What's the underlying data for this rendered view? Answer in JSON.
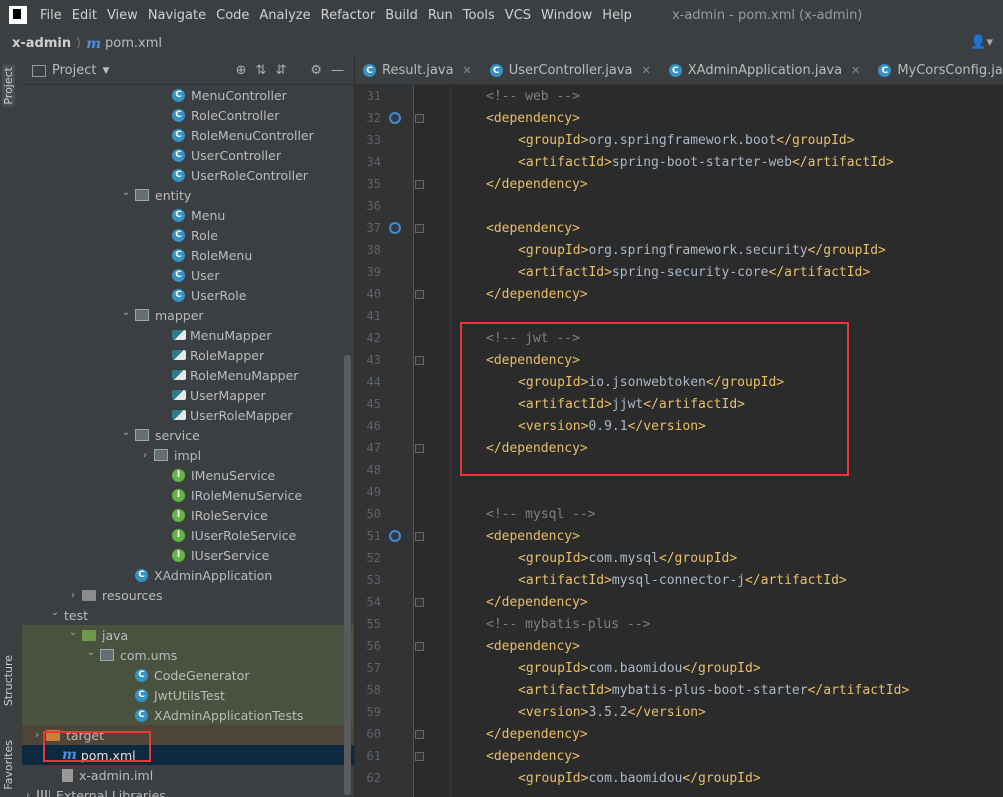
{
  "menubar": {
    "items": [
      "File",
      "Edit",
      "View",
      "Navigate",
      "Code",
      "Analyze",
      "Refactor",
      "Build",
      "Run",
      "Tools",
      "VCS",
      "Window",
      "Help"
    ],
    "window_title": "x-admin - pom.xml (x-admin)"
  },
  "navbar": {
    "project": "x-admin",
    "file": "pom.xml",
    "file_icon": "m"
  },
  "sidebar": {
    "project_tab": "Project",
    "structure_tab": "Structure",
    "favorites_tab": "Favorites"
  },
  "project_panel": {
    "title": "Project",
    "tree": [
      {
        "indent": 150,
        "arrow": "",
        "icon": "c",
        "label": "MenuController"
      },
      {
        "indent": 150,
        "arrow": "",
        "icon": "c",
        "label": "RoleController"
      },
      {
        "indent": 150,
        "arrow": "",
        "icon": "c",
        "label": "RoleMenuController"
      },
      {
        "indent": 150,
        "arrow": "",
        "icon": "c",
        "label": "UserController"
      },
      {
        "indent": 150,
        "arrow": "",
        "icon": "c",
        "label": "UserRoleController"
      },
      {
        "indent": 113,
        "arrow": "down",
        "icon": "pkg",
        "label": "entity"
      },
      {
        "indent": 150,
        "arrow": "",
        "icon": "c",
        "label": "Menu"
      },
      {
        "indent": 150,
        "arrow": "",
        "icon": "c",
        "label": "Role"
      },
      {
        "indent": 150,
        "arrow": "",
        "icon": "c",
        "label": "RoleMenu"
      },
      {
        "indent": 150,
        "arrow": "",
        "icon": "c",
        "label": "User"
      },
      {
        "indent": 150,
        "arrow": "",
        "icon": "c",
        "label": "UserRole"
      },
      {
        "indent": 113,
        "arrow": "down",
        "icon": "pkg",
        "label": "mapper"
      },
      {
        "indent": 150,
        "arrow": "",
        "icon": "mapper",
        "label": "MenuMapper"
      },
      {
        "indent": 150,
        "arrow": "",
        "icon": "mapper",
        "label": "RoleMapper"
      },
      {
        "indent": 150,
        "arrow": "",
        "icon": "mapper",
        "label": "RoleMenuMapper"
      },
      {
        "indent": 150,
        "arrow": "",
        "icon": "mapper",
        "label": "UserMapper"
      },
      {
        "indent": 150,
        "arrow": "",
        "icon": "mapper",
        "label": "UserRoleMapper"
      },
      {
        "indent": 113,
        "arrow": "down",
        "icon": "pkg",
        "label": "service"
      },
      {
        "indent": 132,
        "arrow": "right",
        "icon": "pkg",
        "label": "impl"
      },
      {
        "indent": 150,
        "arrow": "",
        "icon": "i",
        "label": "IMenuService"
      },
      {
        "indent": 150,
        "arrow": "",
        "icon": "i",
        "label": "IRoleMenuService"
      },
      {
        "indent": 150,
        "arrow": "",
        "icon": "i",
        "label": "IRoleService"
      },
      {
        "indent": 150,
        "arrow": "",
        "icon": "i",
        "label": "IUserRoleService"
      },
      {
        "indent": 150,
        "arrow": "",
        "icon": "i",
        "label": "IUserService"
      },
      {
        "indent": 113,
        "arrow": "",
        "icon": "c",
        "label": "XAdminApplication"
      },
      {
        "indent": 60,
        "arrow": "right",
        "icon": "folder-grey",
        "label": "resources"
      },
      {
        "indent": 42,
        "arrow": "down",
        "icon": "",
        "label": "test"
      },
      {
        "indent": 60,
        "arrow": "down",
        "icon": "folder-green",
        "label": "java",
        "hl": "green"
      },
      {
        "indent": 78,
        "arrow": "down",
        "icon": "pkg",
        "label": "com.ums",
        "hl": "green"
      },
      {
        "indent": 113,
        "arrow": "",
        "icon": "c",
        "label": "CodeGenerator",
        "hl": "green"
      },
      {
        "indent": 113,
        "arrow": "",
        "icon": "c",
        "label": "JwtUtilsTest",
        "hl": "green"
      },
      {
        "indent": 113,
        "arrow": "",
        "icon": "c",
        "label": "XAdminApplicationTests",
        "hl": "green"
      },
      {
        "indent": 24,
        "arrow": "right",
        "icon": "folder-orange",
        "label": "target",
        "hl": "brown"
      },
      {
        "indent": 40,
        "arrow": "",
        "icon": "m",
        "label": "pom.xml",
        "sel": true
      },
      {
        "indent": 40,
        "arrow": "",
        "icon": "iml",
        "label": "x-admin.iml"
      },
      {
        "indent": 6,
        "arrow": "right",
        "icon": "libs",
        "label": "External Libraries"
      }
    ]
  },
  "editor": {
    "tabs": [
      "Result.java",
      "UserController.java",
      "XAdminApplication.java",
      "MyCorsConfig.java"
    ],
    "lines": [
      {
        "n": "31",
        "indent": 2,
        "parts": [
          {
            "c": "cm",
            "t": "<!-- web -->"
          }
        ]
      },
      {
        "n": "32",
        "indent": 2,
        "mark": true,
        "fold": true,
        "parts": [
          {
            "c": "tg",
            "t": "<dependency>"
          }
        ]
      },
      {
        "n": "33",
        "indent": 4,
        "parts": [
          {
            "c": "tg",
            "t": "<groupId>"
          },
          {
            "c": "tx",
            "t": "org.springframework.boot"
          },
          {
            "c": "tg",
            "t": "</groupId>"
          }
        ]
      },
      {
        "n": "34",
        "indent": 4,
        "parts": [
          {
            "c": "tg",
            "t": "<artifactId>"
          },
          {
            "c": "tx",
            "t": "spring-boot-starter-web"
          },
          {
            "c": "tg",
            "t": "</artifactId>"
          }
        ]
      },
      {
        "n": "35",
        "indent": 2,
        "fold": true,
        "parts": [
          {
            "c": "tg",
            "t": "</dependency>"
          }
        ]
      },
      {
        "n": "36",
        "indent": 0,
        "parts": []
      },
      {
        "n": "37",
        "indent": 2,
        "mark": true,
        "fold": true,
        "parts": [
          {
            "c": "tg",
            "t": "<dependency>"
          }
        ]
      },
      {
        "n": "38",
        "indent": 4,
        "parts": [
          {
            "c": "tg",
            "t": "<groupId>"
          },
          {
            "c": "tx",
            "t": "org.springframework.security"
          },
          {
            "c": "tg",
            "t": "</groupId>"
          }
        ]
      },
      {
        "n": "39",
        "indent": 4,
        "parts": [
          {
            "c": "tg",
            "t": "<artifactId>"
          },
          {
            "c": "tx",
            "t": "spring-security-core"
          },
          {
            "c": "tg",
            "t": "</artifactId>"
          }
        ]
      },
      {
        "n": "40",
        "indent": 2,
        "fold": true,
        "parts": [
          {
            "c": "tg",
            "t": "</dependency>"
          }
        ]
      },
      {
        "n": "41",
        "indent": 0,
        "parts": []
      },
      {
        "n": "42",
        "indent": 2,
        "parts": [
          {
            "c": "cm",
            "t": "<!-- jwt -->"
          }
        ]
      },
      {
        "n": "43",
        "indent": 2,
        "fold": true,
        "parts": [
          {
            "c": "tg",
            "t": "<dependency>"
          }
        ]
      },
      {
        "n": "44",
        "indent": 4,
        "parts": [
          {
            "c": "tg",
            "t": "<groupId>"
          },
          {
            "c": "tx",
            "t": "io.jsonwebtoken"
          },
          {
            "c": "tg",
            "t": "</groupId>"
          }
        ]
      },
      {
        "n": "45",
        "indent": 4,
        "parts": [
          {
            "c": "tg",
            "t": "<artifactId>"
          },
          {
            "c": "tx",
            "t": "jjwt"
          },
          {
            "c": "tg",
            "t": "</artifactId>"
          }
        ]
      },
      {
        "n": "46",
        "indent": 4,
        "parts": [
          {
            "c": "tg",
            "t": "<version>"
          },
          {
            "c": "tx",
            "t": "0.9.1"
          },
          {
            "c": "tg",
            "t": "</version>"
          }
        ]
      },
      {
        "n": "47",
        "indent": 2,
        "fold": true,
        "parts": [
          {
            "c": "tg",
            "t": "</dependency>"
          }
        ]
      },
      {
        "n": "48",
        "indent": 0,
        "parts": []
      },
      {
        "n": "49",
        "indent": 0,
        "parts": []
      },
      {
        "n": "50",
        "indent": 2,
        "parts": [
          {
            "c": "cm",
            "t": "<!-- mysql -->"
          }
        ]
      },
      {
        "n": "51",
        "indent": 2,
        "mark": true,
        "fold": true,
        "parts": [
          {
            "c": "tg",
            "t": "<dependency>"
          }
        ]
      },
      {
        "n": "52",
        "indent": 4,
        "parts": [
          {
            "c": "tg",
            "t": "<groupId>"
          },
          {
            "c": "tx",
            "t": "com.mysql"
          },
          {
            "c": "tg",
            "t": "</groupId>"
          }
        ]
      },
      {
        "n": "53",
        "indent": 4,
        "parts": [
          {
            "c": "tg",
            "t": "<artifactId>"
          },
          {
            "c": "tx",
            "t": "mysql-connector-j"
          },
          {
            "c": "tg",
            "t": "</artifactId>"
          }
        ]
      },
      {
        "n": "54",
        "indent": 2,
        "fold": true,
        "parts": [
          {
            "c": "tg",
            "t": "</dependency>"
          }
        ]
      },
      {
        "n": "55",
        "indent": 2,
        "parts": [
          {
            "c": "cm",
            "t": "<!-- mybatis-plus -->"
          }
        ]
      },
      {
        "n": "56",
        "indent": 2,
        "fold": true,
        "parts": [
          {
            "c": "tg",
            "t": "<dependency>"
          }
        ]
      },
      {
        "n": "57",
        "indent": 4,
        "parts": [
          {
            "c": "tg",
            "t": "<groupId>"
          },
          {
            "c": "tx",
            "t": "com.baomidou"
          },
          {
            "c": "tg",
            "t": "</groupId>"
          }
        ]
      },
      {
        "n": "58",
        "indent": 4,
        "parts": [
          {
            "c": "tg",
            "t": "<artifactId>"
          },
          {
            "c": "tx",
            "t": "mybatis-plus-boot-starter"
          },
          {
            "c": "tg",
            "t": "</artifactId>"
          }
        ]
      },
      {
        "n": "59",
        "indent": 4,
        "parts": [
          {
            "c": "tg",
            "t": "<version>"
          },
          {
            "c": "tx",
            "t": "3.5.2"
          },
          {
            "c": "tg",
            "t": "</version>"
          }
        ]
      },
      {
        "n": "60",
        "indent": 2,
        "fold": true,
        "parts": [
          {
            "c": "tg",
            "t": "</dependency>"
          }
        ]
      },
      {
        "n": "61",
        "indent": 2,
        "fold": true,
        "parts": [
          {
            "c": "tg",
            "t": "<dependency>"
          }
        ]
      },
      {
        "n": "62",
        "indent": 4,
        "parts": [
          {
            "c": "tg",
            "t": "<groupId>"
          },
          {
            "c": "tx",
            "t": "com.baomidou"
          },
          {
            "c": "tg",
            "t": "</groupId>"
          }
        ]
      }
    ]
  },
  "colors": {
    "highlight_box": "#e53935",
    "tag": "#e8bf6a",
    "comment": "#808080",
    "text": "#a9b7c6"
  }
}
